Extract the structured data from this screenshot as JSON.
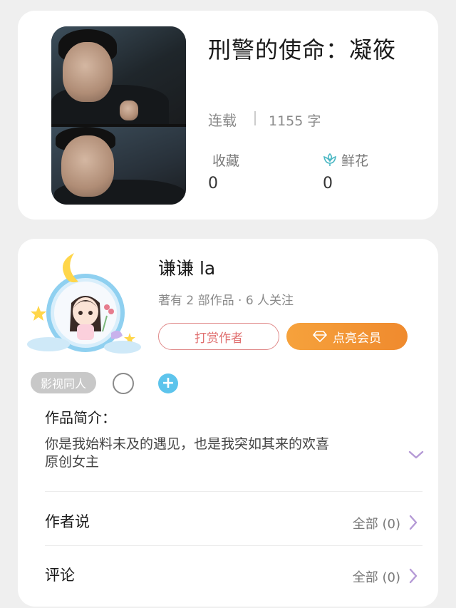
{
  "book": {
    "title": "刑警的使命：凝筱",
    "status": "连载",
    "word_count": "1155 字",
    "stats": {
      "favorites_label": "收藏",
      "favorites_value": "0",
      "flowers_label": "鲜花",
      "flowers_value": "0"
    }
  },
  "author": {
    "name": "谦谦 la",
    "meta": "著有 2 部作品 · 6 人关注",
    "tip_button": "打赏作者",
    "vip_button": "点亮会员",
    "tag": "影视同人"
  },
  "intro": {
    "title": "作品简介：",
    "line1": "你是我始料未及的遇见，也是我突如其来的欢喜",
    "line2": "原创女主"
  },
  "rows": {
    "author_says": {
      "label": "作者说",
      "count": "全部 (0)"
    },
    "comments": {
      "label": "评论",
      "count": "全部 (0)"
    }
  },
  "colors": {
    "accent_purple": "#b59ad6",
    "vip_orange": "#f09030",
    "tip_red": "#e06f6f",
    "add_blue": "#5dc4ec"
  }
}
